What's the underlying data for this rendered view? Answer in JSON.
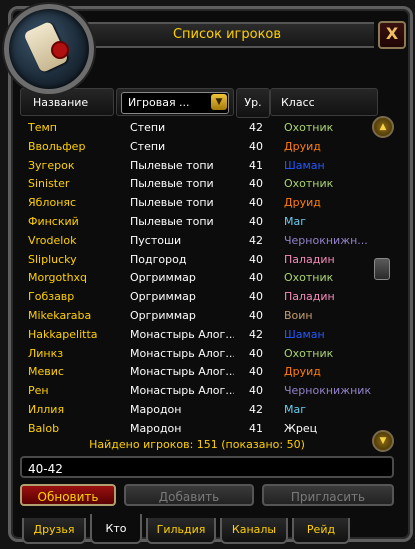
{
  "window": {
    "title": "Список игроков",
    "close_glyph": "X"
  },
  "columns": {
    "name": "Название",
    "zone": "Игровая ...",
    "level": "Ур.",
    "class": "Класс"
  },
  "class_colors": {
    "Охотник": "#abd473",
    "Друид": "#ff7d0a",
    "Шаман": "#2459ff",
    "Маг": "#69ccf0",
    "Чернокнижник": "#9482c9",
    "Паладин": "#f58cba",
    "Воин": "#c79c6e",
    "Жрец": "#ffffff"
  },
  "players": [
    {
      "name": "Темп",
      "zone": "Степи",
      "level": "42",
      "class": "Охотник",
      "color": "#abd473"
    },
    {
      "name": "Ввольфер",
      "zone": "Степи",
      "level": "40",
      "class": "Друид",
      "color": "#ff7d0a"
    },
    {
      "name": "Зугерок",
      "zone": "Пылевые топи",
      "level": "41",
      "class": "Шаман",
      "color": "#2459ff"
    },
    {
      "name": "Sinister",
      "zone": "Пылевые топи",
      "level": "40",
      "class": "Охотник",
      "color": "#abd473"
    },
    {
      "name": "Яблоняс",
      "zone": "Пылевые топи",
      "level": "40",
      "class": "Друид",
      "color": "#ff7d0a"
    },
    {
      "name": "Финский",
      "zone": "Пылевые топи",
      "level": "40",
      "class": "Маг",
      "color": "#69ccf0"
    },
    {
      "name": "Vrodelok",
      "zone": "Пустоши",
      "level": "42",
      "class": "Чернокнижн...",
      "color": "#9482c9"
    },
    {
      "name": "Sliplucky",
      "zone": "Подгород",
      "level": "40",
      "class": "Паладин",
      "color": "#f58cba"
    },
    {
      "name": "Morgothxq",
      "zone": "Оргриммар",
      "level": "40",
      "class": "Охотник",
      "color": "#abd473"
    },
    {
      "name": "Гобзавр",
      "zone": "Оргриммар",
      "level": "40",
      "class": "Паладин",
      "color": "#f58cba"
    },
    {
      "name": "Mikekaraba",
      "zone": "Оргриммар",
      "level": "40",
      "class": "Воин",
      "color": "#c79c6e"
    },
    {
      "name": "Hakkapelitta",
      "zone": "Монастырь Алог...",
      "level": "42",
      "class": "Шаман",
      "color": "#2459ff"
    },
    {
      "name": "Линкз",
      "zone": "Монастырь Алог...",
      "level": "40",
      "class": "Охотник",
      "color": "#abd473"
    },
    {
      "name": "Мевис",
      "zone": "Монастырь Алог...",
      "level": "40",
      "class": "Друид",
      "color": "#ff7d0a"
    },
    {
      "name": "Рен",
      "zone": "Монастырь Алог...",
      "level": "40",
      "class": "Чернокнижник",
      "color": "#9482c9"
    },
    {
      "name": "Иллия",
      "zone": "Мародон",
      "level": "42",
      "class": "Маг",
      "color": "#69ccf0"
    },
    {
      "name": "Balob",
      "zone": "Мародон",
      "level": "41",
      "class": "Жрец",
      "color": "#ffffff"
    }
  ],
  "found_text": "Найдено игроков: 151 (показано: 50)",
  "search": {
    "value": "40-42"
  },
  "buttons": {
    "refresh": "Обновить",
    "add": "Добавить",
    "invite": "Пригласить"
  },
  "tabs": [
    "Друзья",
    "Кто",
    "Гильдия",
    "Каналы",
    "Рейд"
  ],
  "active_tab": "Кто",
  "icons": {
    "portrait": "scroll-icon",
    "zone_dropdown": "dropdown-arrow-icon",
    "scroll_up": "scroll-up-icon",
    "scroll_down": "scroll-down-icon"
  }
}
